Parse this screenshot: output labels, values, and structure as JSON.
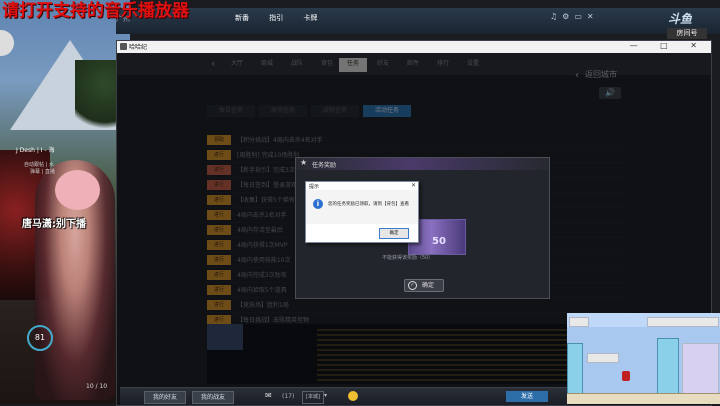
{
  "overlay": {
    "banner_text": "请打开支持的音乐播放器",
    "streamer_name": "J Desh | I - 海",
    "streamer_sub": "自动跟帖 | 水",
    "streamer_sub2": "弹幕 | 直播",
    "center_text": "唐马潇:别下播",
    "health_value": "81",
    "player_hp": "10 / 10"
  },
  "game": {
    "city_label": "广州",
    "top_tabs": [
      "新番",
      "指引",
      "卡牌"
    ],
    "logo": "斗鱼",
    "room_badge": "房间号"
  },
  "window": {
    "title": "哈哈纪",
    "controls": "— □ ✕",
    "back_city": "返回城市",
    "nav_items": [
      "大厅",
      "商城",
      "战队",
      "背包",
      "好友",
      "任务",
      "邮件",
      "排行",
      "设置"
    ],
    "active_nav_index": 5,
    "subtabs": [
      "每日任务",
      "周常任务",
      "成就任务",
      "活动任务"
    ],
    "active_subtab_index": 3,
    "speaker_icon": "🔊"
  },
  "tasks": [
    {
      "badge": "领取",
      "text": "【积分挑战】4局内击杀4名对手",
      "red": false
    },
    {
      "badge": "进行",
      "text": "[周胜利] 完成10场胜利",
      "red": false
    },
    {
      "badge": "进行",
      "text": "【新手指引】完成3次匹配对战",
      "red": true
    },
    {
      "badge": "进行",
      "text": "【每日签到】登录游戏领取奖励",
      "red": true
    },
    {
      "badge": "进行",
      "text": "【收集】获得5个稀有道具",
      "red": false
    },
    {
      "badge": "进行",
      "text": "4局内击杀2名对手",
      "red": false
    },
    {
      "badge": "进行",
      "text": "4局内存活至最后",
      "red": false
    },
    {
      "badge": "进行",
      "text": "4局内获得1次MVP",
      "red": false
    },
    {
      "badge": "进行",
      "text": "4局内使用技能10次",
      "red": false
    },
    {
      "badge": "进行",
      "text": "4局内完成3次助攻",
      "red": false
    },
    {
      "badge": "进行",
      "text": "4局内拾取5个道具",
      "red": false
    },
    {
      "badge": "进行",
      "text": "【竞技场】胜利1局",
      "red": false
    },
    {
      "badge": "进行",
      "text": "【每日挑战】击败精英怪物",
      "red": false
    }
  ],
  "reward_dialog": {
    "title": "任务奖励",
    "item_value": "50",
    "desc": "不能获得该奖励（50）",
    "ok_label": "确定"
  },
  "msgbox": {
    "title": "提示",
    "close": "✕",
    "text": "您的任务奖励已领取，请到【背包】查看",
    "ok_label": "确定"
  },
  "taskbar": {
    "friends_label": "我的好友",
    "team_label": "我的战友",
    "mail_icon": "✉",
    "count": "(17)",
    "channel": "[本城]",
    "dropdown": "▾",
    "send_label": "发送"
  }
}
